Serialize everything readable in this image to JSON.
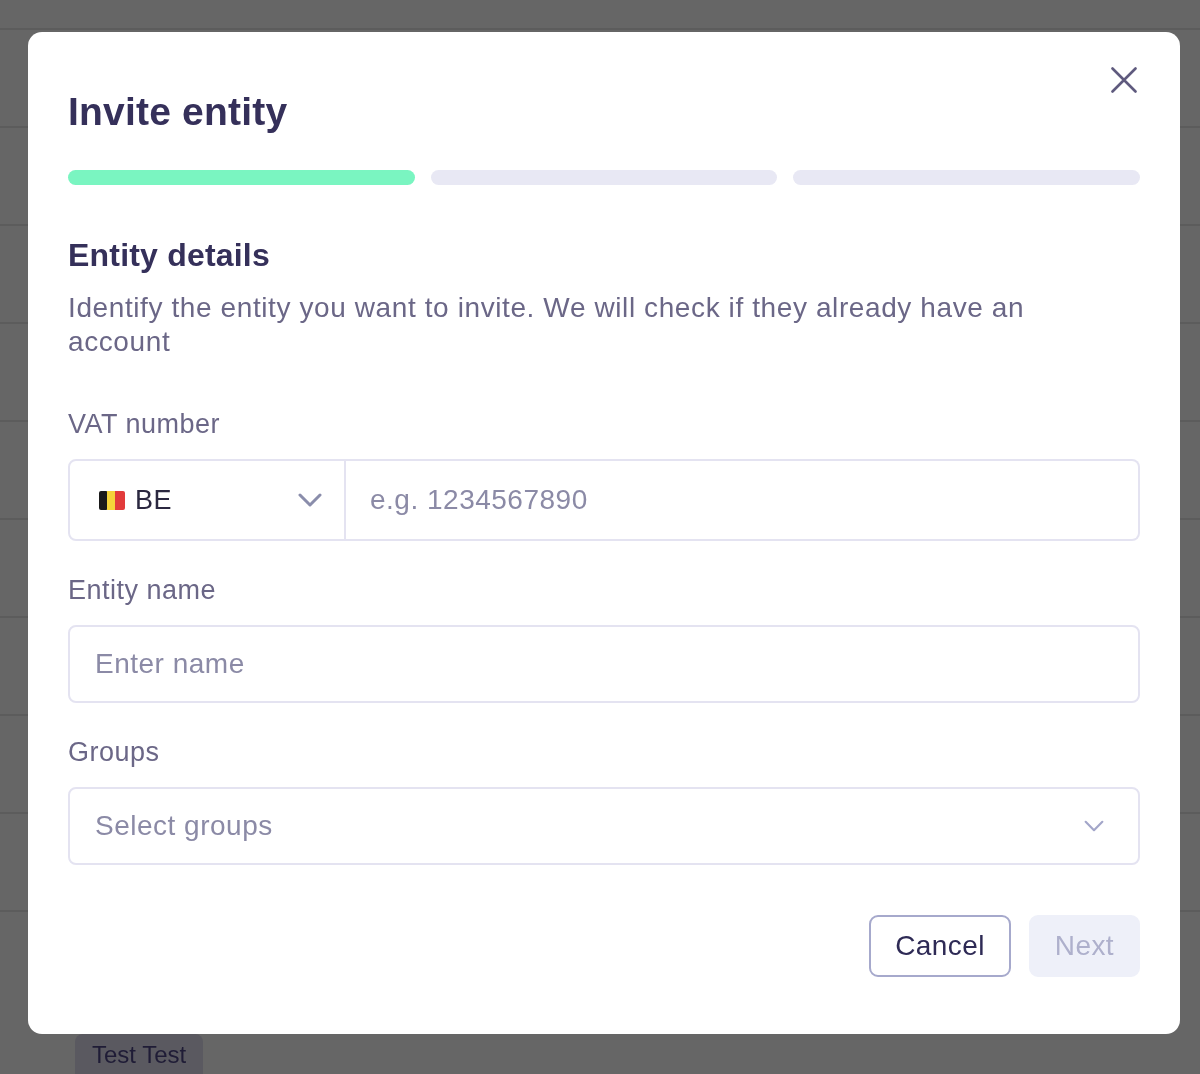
{
  "dialog": {
    "title": "Invite entity",
    "steps": [
      {
        "done": true
      },
      {
        "done": false
      },
      {
        "done": false
      }
    ],
    "section": {
      "heading": "Entity details",
      "description": "Identify the entity you want to invite. We will check if they already have an account"
    },
    "fields": [
      {
        "kind": "vat",
        "label": "VAT number",
        "country_code": "BE",
        "placeholder": "e.g. 1234567890"
      },
      {
        "kind": "text",
        "label": "Entity name",
        "placeholder": "Enter name"
      },
      {
        "kind": "select",
        "label": "Groups",
        "placeholder": "Select groups"
      }
    ],
    "buttons": [
      {
        "label": "Cancel",
        "kind": "secondary",
        "disabled": false
      },
      {
        "label": "Next",
        "kind": "primary",
        "disabled": true
      }
    ]
  },
  "backdrop": {
    "tag": "Test Test"
  }
}
